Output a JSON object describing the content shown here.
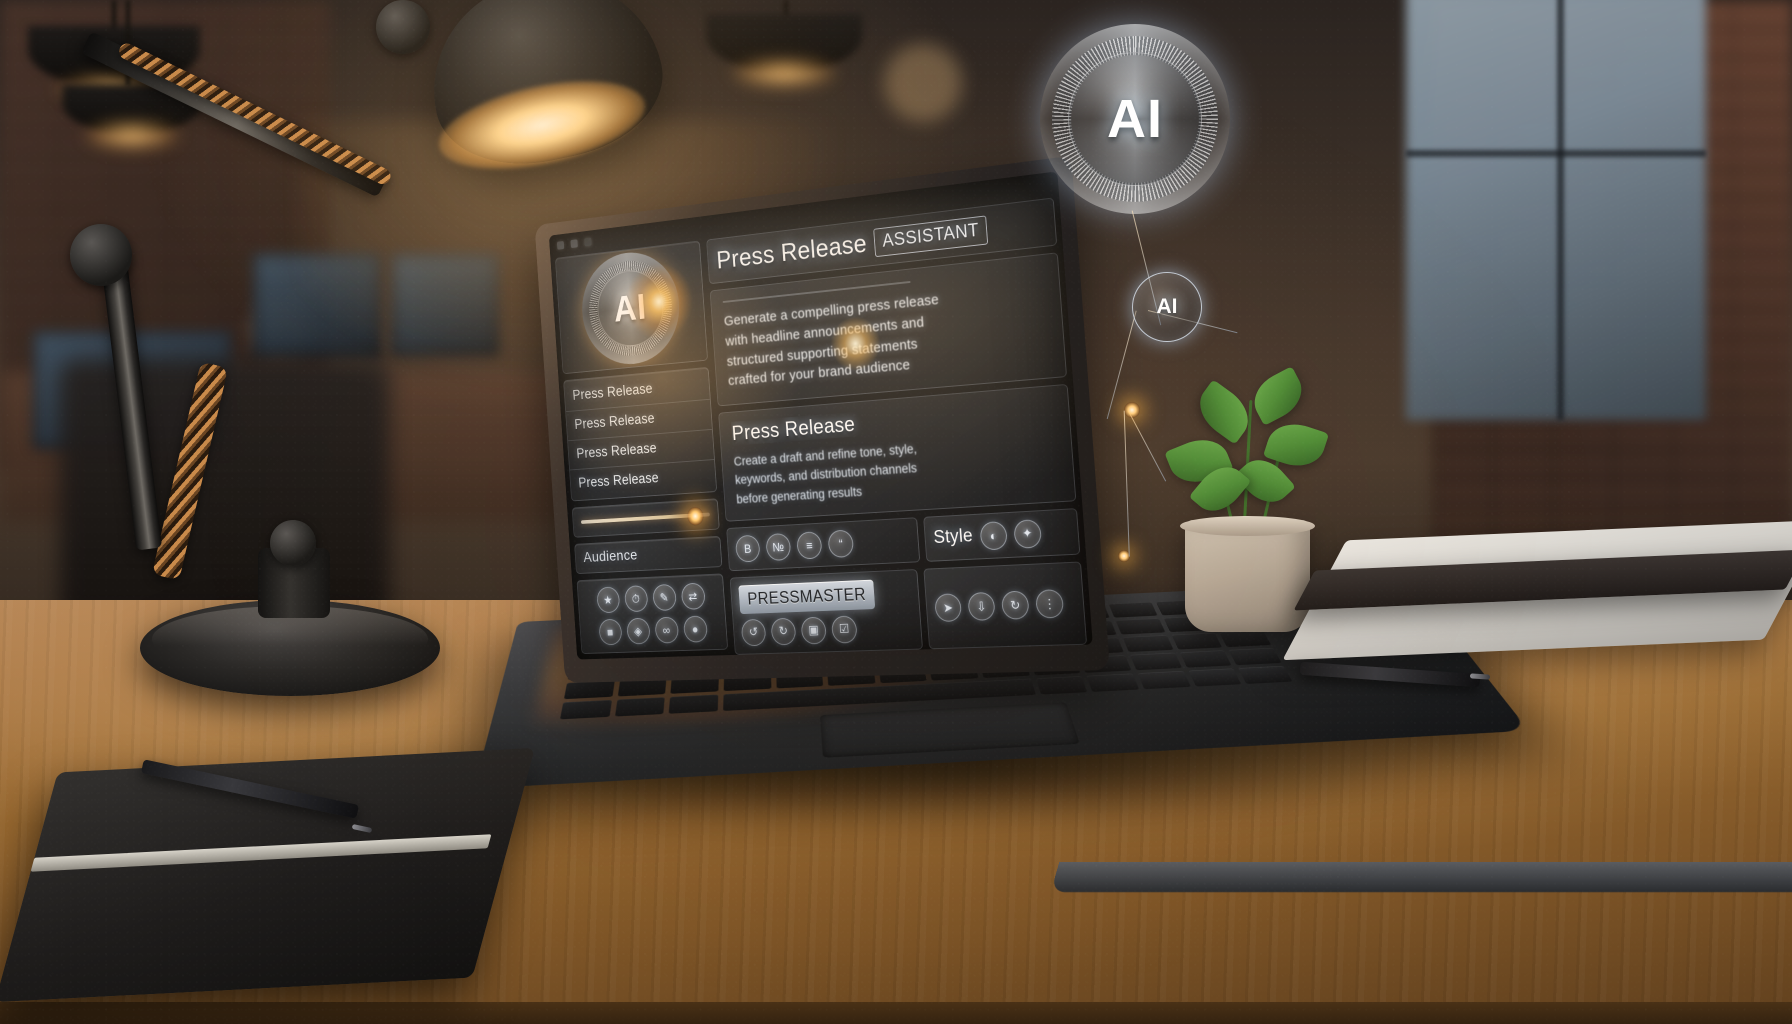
{
  "scene": {
    "description": "Photorealistic office desk scene with a laptop showing an AI press release assistant UI",
    "setting": "modern brick-walled office at dusk with pendant lamps and a desk lamp"
  },
  "laptop_ui": {
    "window_controls": [
      "control-1",
      "control-2",
      "control-3"
    ],
    "sidebar": {
      "logo": {
        "text": "AI",
        "icon": "ai-circle-emblem"
      },
      "menu_items": [
        {
          "label": "Press Release"
        },
        {
          "label": "Press Release"
        },
        {
          "label": "Press Release"
        },
        {
          "label": "Press Release"
        }
      ],
      "slider": {
        "name": "tone-slider",
        "value_position_pct": 86
      },
      "section_label": "Audience",
      "icon_rows": [
        [
          "bookmark-icon",
          "clock-icon",
          "edit-icon",
          "share-icon"
        ],
        [
          "briefcase-icon",
          "tag-icon",
          "link-icon",
          "user-icon"
        ]
      ]
    },
    "main": {
      "title": "Press Release",
      "badge": "ASSISTANT",
      "body_paragraph": [
        "Generate a compelling press release",
        "with headline announcements and",
        "structured supporting statements",
        "crafted for your brand audience"
      ],
      "section": {
        "heading": "Press Release",
        "lines": [
          "Create a draft and refine tone, style,",
          "keywords, and distribution channels",
          "before generating results"
        ]
      },
      "toolbar": {
        "left_icons": [
          "bold-icon",
          "italic-icon",
          "list-icon",
          "quote-icon"
        ],
        "style_label": "Style",
        "style_icons": [
          "palette-icon",
          "sparkle-icon"
        ],
        "cta_label": "PRESSMASTER",
        "bottom_left_icons": [
          "undo-icon",
          "redo-icon",
          "copy-icon",
          "save-icon"
        ],
        "bottom_right_icons": [
          "send-icon",
          "download-icon",
          "refresh-icon",
          "more-icon"
        ]
      }
    }
  },
  "hologram": {
    "main_node_label": "AI",
    "secondary_node_label": "AI",
    "node_count": 3
  },
  "colors": {
    "accent_glow": "#ffb347",
    "ui_text": "#f0f5fb",
    "panel_border": "#bec8d7",
    "desk_wood": "#96672f",
    "plant_green": "#4f8c37",
    "cta_bg": "#e2eaf4"
  }
}
